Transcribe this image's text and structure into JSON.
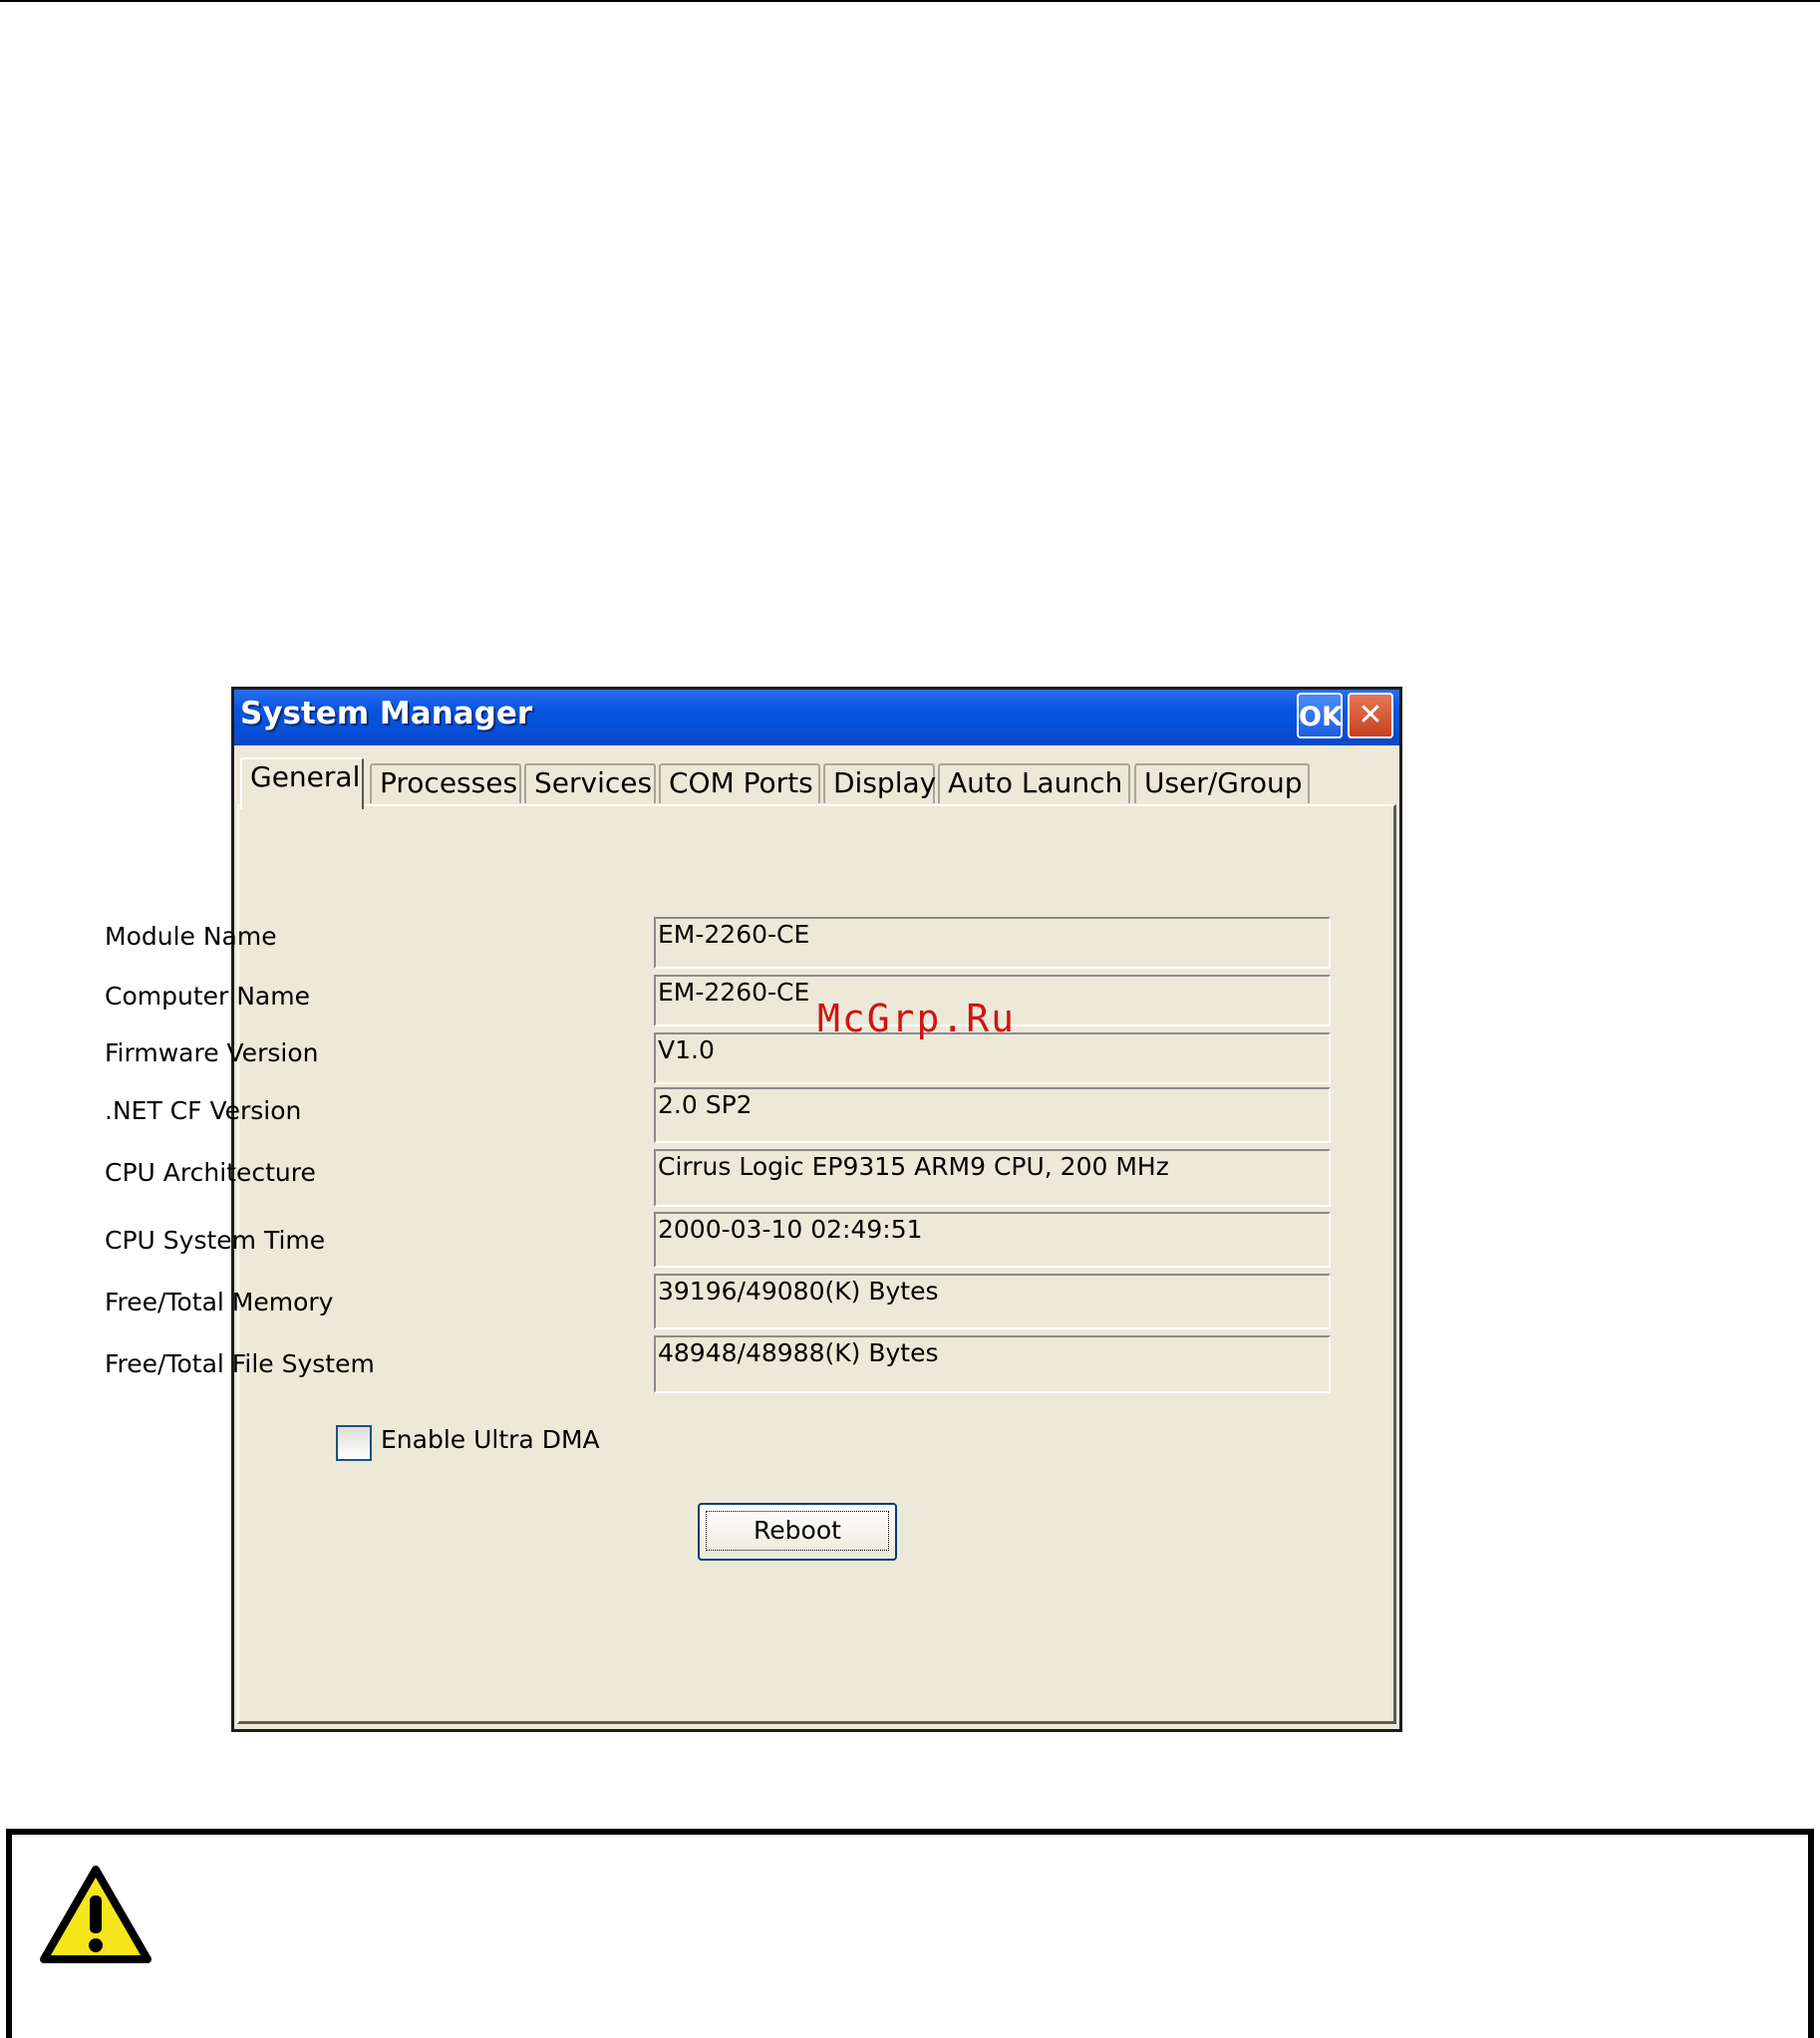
{
  "window": {
    "title": "System Manager",
    "ok_label": "OK",
    "close_label": "✕"
  },
  "tabs": [
    {
      "label": "General",
      "active": true
    },
    {
      "label": "Processes"
    },
    {
      "label": "Services"
    },
    {
      "label": "COM Ports"
    },
    {
      "label": "Display"
    },
    {
      "label": "Auto Launch"
    },
    {
      "label": "User/Group"
    }
  ],
  "fields": [
    {
      "label": "Module Name",
      "value": "EM-2260-CE"
    },
    {
      "label": "Computer Name",
      "value": "EM-2260-CE"
    },
    {
      "label": "Firmware Version",
      "value": "V1.0"
    },
    {
      "label": ".NET CF Version",
      "value": "2.0 SP2"
    },
    {
      "label": "CPU Architecture",
      "value": "Cirrus Logic EP9315 ARM9 CPU, 200 MHz"
    },
    {
      "label": "CPU System Time",
      "value": "2000-03-10 02:49:51"
    },
    {
      "label": "Free/Total Memory",
      "value": "39196/49080(K) Bytes"
    },
    {
      "label": "Free/Total File System",
      "value": "48948/48988(K) Bytes"
    }
  ],
  "checkbox": {
    "label": "Enable Ultra DMA",
    "checked": false
  },
  "reboot_label": "Reboot",
  "watermark": "McGrp.Ru",
  "icon": "warning-triangle-icon",
  "colors": {
    "titlebar": "#0a55e0",
    "dialog_bg": "#ece9d8",
    "watermark": "#d01414",
    "warning_fill": "#f5e51b"
  }
}
